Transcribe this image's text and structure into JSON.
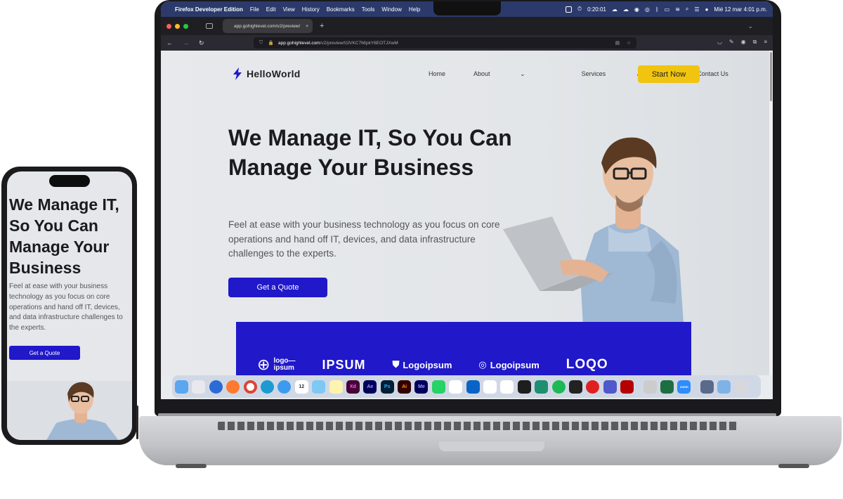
{
  "menubar": {
    "app_name": "Firefox Developer Edition",
    "items": [
      "File",
      "Edit",
      "View",
      "History",
      "Bookmarks",
      "Tools",
      "Window",
      "Help"
    ],
    "timer": "0:20:01",
    "clock": "Mié 12 mar  4:01 p.m."
  },
  "browser": {
    "tab_title": "app.gohighlevel.com/v2/preview/",
    "tab_close": "×",
    "new_tab": "+",
    "url_host": "app.gohighlevel.com",
    "url_path": "/v2/preview/t1lVKC7MipkY6EOTJXwM"
  },
  "site": {
    "logo_text": "HelloWorld",
    "nav": {
      "home": "Home",
      "about": "About",
      "services": "Services",
      "contact": "Contact Us"
    },
    "start_button": "Start Now",
    "hero_title": "We Manage IT, So You Can Manage Your Business",
    "hero_text": "Feel at ease with your business technology as you focus on core operations and hand off IT, devices, and data infrastructure challenges to the experts.",
    "quote_button": "Get a Quote",
    "partner_logos": {
      "logo1_a": "logo—",
      "logo1_b": "ipsum",
      "logo2": "IPSUM",
      "logo3": "Logoipsum",
      "logo4": "Logoipsum",
      "logo5": "LOQO"
    }
  },
  "dock": {
    "labels": [
      "12",
      "Xd",
      "Ae",
      "Ps",
      "Ai",
      "Me",
      "zoom"
    ]
  },
  "phone": {
    "hero_title": "We Manage IT, So You Can Manage Your Business",
    "hero_text": "Feel at ease with your business technology as you focus on core operations and hand off IT, devices, and data infrastructure challenges to the experts.",
    "quote_button": "Get a Quote"
  },
  "colors": {
    "brand_blue": "#2018c9",
    "accent_yellow": "#f1c40f",
    "menubar": "#2b3a6b"
  }
}
